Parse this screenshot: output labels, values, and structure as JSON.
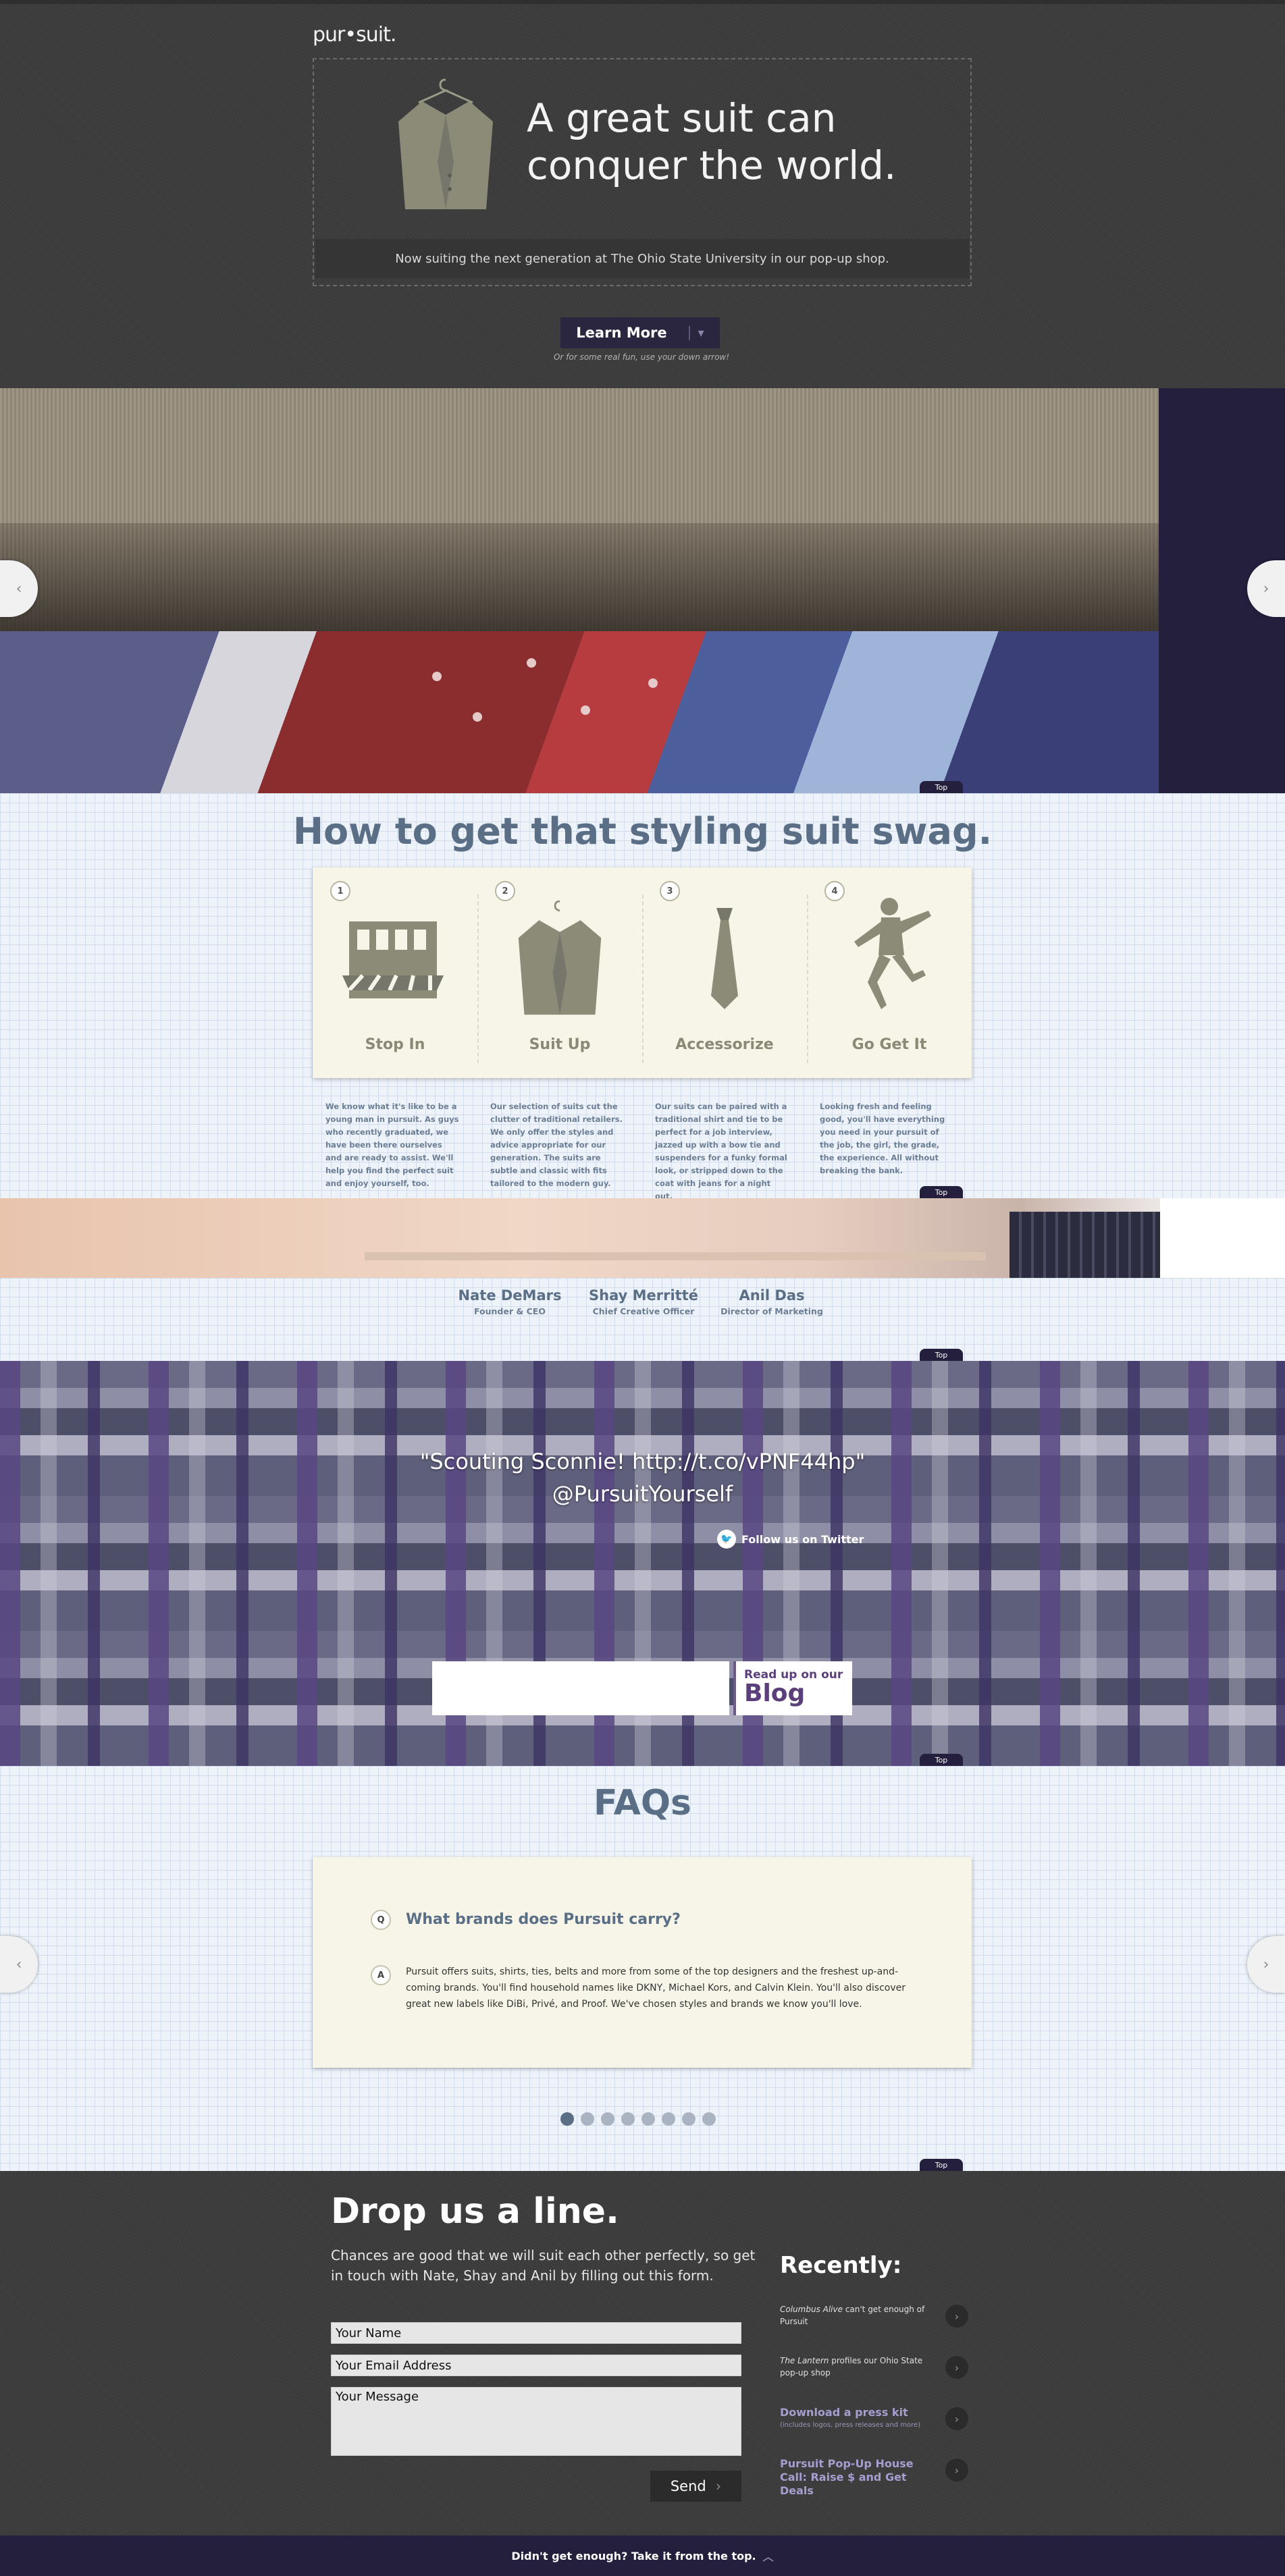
{
  "header": {
    "logo": "pur•suit.",
    "headline": "A great suit can conquer the world.",
    "subline": "Now suiting the next generation at The Ohio State University in our pop-up shop.",
    "learn_more_label": "Learn More",
    "arrow_hint": "Or for some real fun, use your down arrow!"
  },
  "slider": {
    "prev_arrow": "‹",
    "next_arrow": "›"
  },
  "top_label": "Top",
  "howto": {
    "title": "How to get that styling suit swag.",
    "steps": [
      {
        "num": "1",
        "label": "Stop In",
        "icon": "storefront-icon",
        "desc": "We know what it's like to be a young man in pursuit. As guys who recently graduated, we have been there ourselves and are ready to assist. We'll help you find the perfect suit and enjoy yourself, too."
      },
      {
        "num": "2",
        "label": "Suit Up",
        "icon": "jacket-icon",
        "desc": "Our selection of suits cut the clutter of traditional retailers. We only offer the styles and advice appropriate for our generation. The suits are subtle and classic with fits tailored to the modern guy."
      },
      {
        "num": "3",
        "label": "Accessorize",
        "icon": "tie-icon",
        "desc": "Our suits can be paired with a traditional shirt and tie to be perfect for a job interview, jazzed up with a bow tie and suspenders for a funky formal look, or stripped down to the coat with jeans for a night out."
      },
      {
        "num": "4",
        "label": "Go Get It",
        "icon": "jumping-man-icon",
        "desc": "Looking fresh and feeling good, you'll have everything you need in your pursuit of the job, the girl, the grade, the experience. All without breaking the bank."
      }
    ]
  },
  "team": {
    "members": [
      {
        "name": "Nate DeMars",
        "role": "Founder & CEO"
      },
      {
        "name": "Shay Merritté",
        "role": "Chief Creative Officer"
      },
      {
        "name": "Anil Das",
        "role": "Director of Marketing"
      }
    ]
  },
  "twitter": {
    "tweet": "\"Scouting Sconnie! http://t.co/vPNF44hp\"",
    "handle": "@PursuitYourself",
    "follow_label": "Follow us on Twitter",
    "blog_line1": "Read up on our",
    "blog_line2": "Blog"
  },
  "faq": {
    "title": "FAQs",
    "q_badge": "Q",
    "a_badge": "A",
    "question": "What brands does Pursuit carry?",
    "answer": "Pursuit offers suits, shirts, ties, belts and more from some of the top designers and the freshest up-and-coming brands. You'll find household names like DKNY, Michael Kors, and Calvin Klein. You'll also discover great new labels like DiBi, Privé, and Proof. We've chosen styles and brands we know you'll love.",
    "dot_count": 8,
    "active_dot": 0
  },
  "contact": {
    "title": "Drop us a line.",
    "intro": "Chances are good that we will suit each other perfectly, so get in touch with Nate, Shay and Anil by filling out this form.",
    "name_value": "Your Name",
    "email_value": "Your Email Address",
    "message_value": "Your Message",
    "send_label": "Send",
    "recent_title": "Recently:",
    "recent": [
      {
        "italic": "Columbus Alive",
        "text": " can't get enough of Pursuit"
      },
      {
        "italic": "The Lantern",
        "text": " profiles our Ohio State pop-up shop"
      },
      {
        "title": "Download a press kit",
        "sub": "(includes logos, press releases and more)"
      },
      {
        "title": "Pursuit Pop-Up House Call: Raise $ and Get Deals"
      }
    ]
  },
  "footer": {
    "text": "Didn't get enough? Take it from the top.",
    "arrow": "︿"
  },
  "colors": {
    "dark_bg": "#3d3d3d",
    "navy": "#241f3c",
    "slate_text": "#5a6f86",
    "card_cream": "#f6f5e8",
    "blog_purple": "#5b3f7a"
  }
}
